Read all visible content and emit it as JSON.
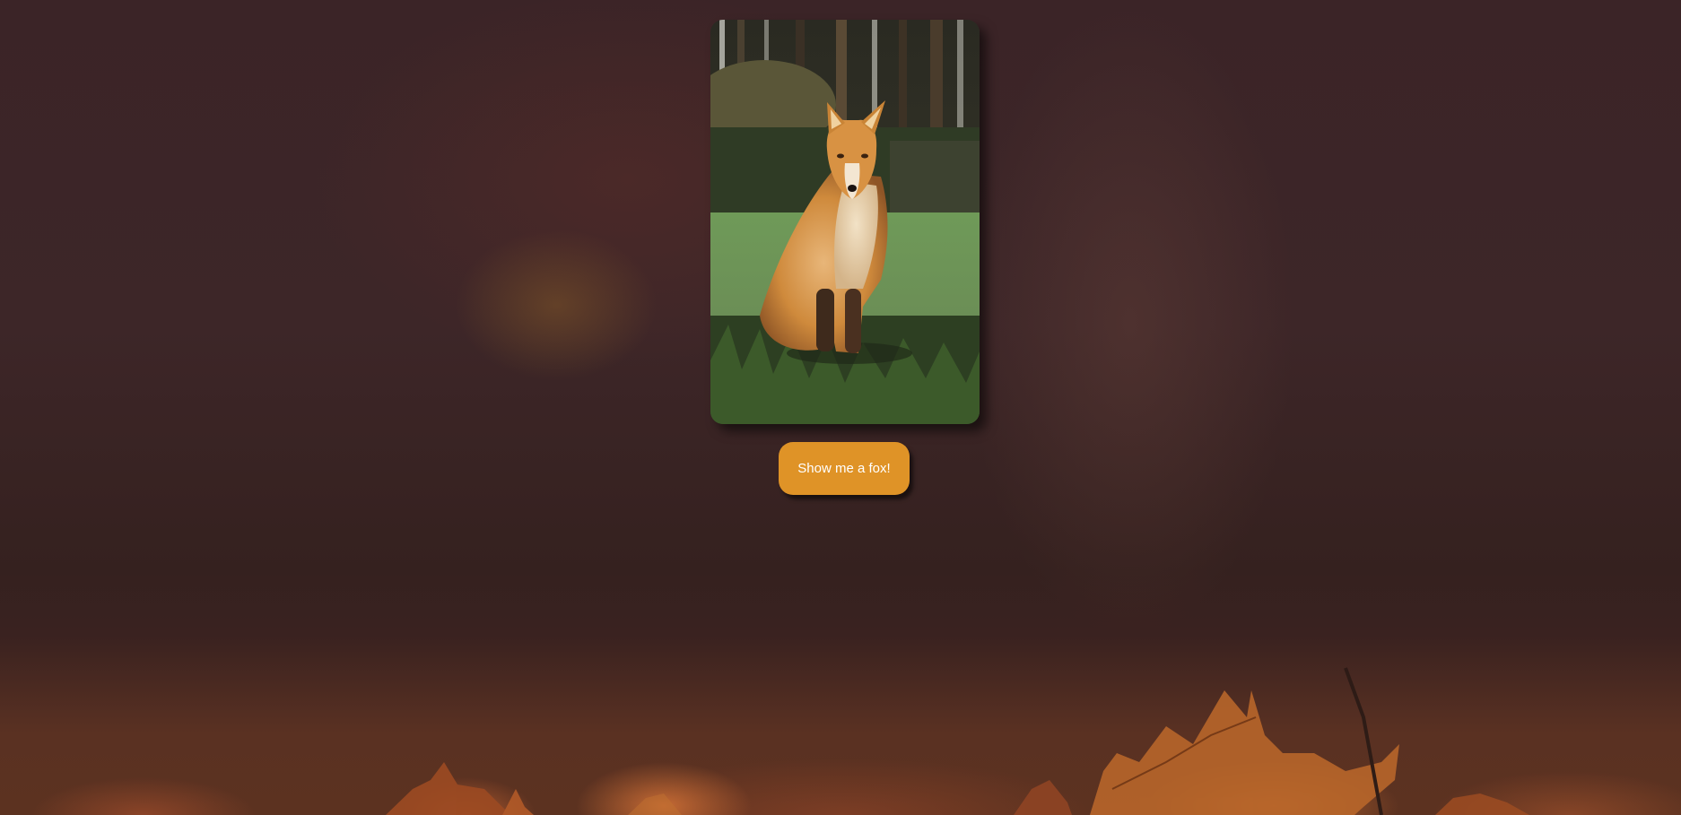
{
  "photo": {
    "subject": "fox",
    "icon": "fox-photo"
  },
  "button": {
    "label": "Show me a fox!",
    "color": "#df9327",
    "text_color": "#ffffff"
  },
  "background": {
    "theme": "autumn-leaves",
    "base_color": "#3a2326"
  }
}
